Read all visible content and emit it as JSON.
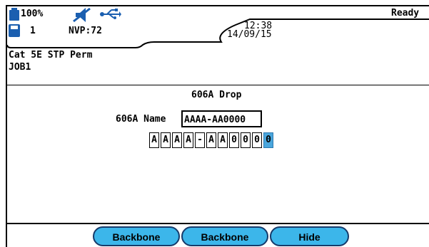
{
  "status": {
    "battery_percent": "100%",
    "battery_level": 1.0,
    "memory_count": "1",
    "nvp": "NVP:72",
    "time": "12:38",
    "date": "14/09/15",
    "ready": "Ready"
  },
  "job": {
    "test_standard": "Cat 5E STP Perm",
    "job_name": "JOB1"
  },
  "main": {
    "title": "606A Drop",
    "name_label": "606A Name",
    "name_value": "AAAA-AA0000",
    "chars": [
      "A",
      "A",
      "A",
      "A",
      "-",
      "A",
      "A",
      "0",
      "0",
      "0",
      "0"
    ],
    "active_char_index": 10
  },
  "softkeys": {
    "key1": "Backbone",
    "key2": "Backbone",
    "key3": "Hide"
  },
  "colors": {
    "softkey_fill": "#3cb6ea",
    "softkey_border": "#163a6a",
    "active_cell": "#4aa6dc",
    "icon_blue": "#1b5fb0"
  }
}
